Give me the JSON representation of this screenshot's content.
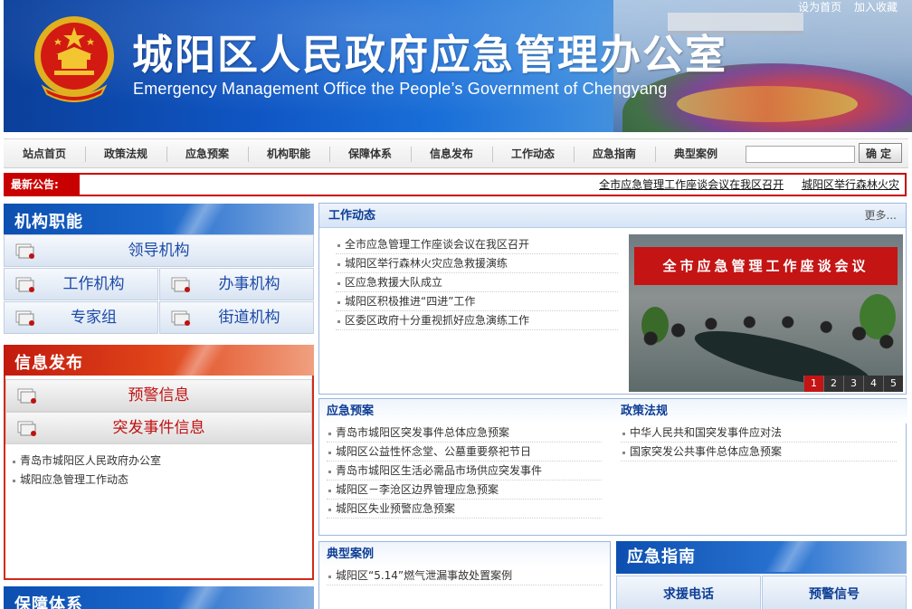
{
  "header": {
    "title": "城阳区人民政府应急管理办公室",
    "subtitle": "Emergency Management Office the People’s Government of Chengyang",
    "top_links": [
      "设为首页",
      "加入收藏"
    ]
  },
  "nav": {
    "items": [
      "站点首页",
      "政策法规",
      "应急预案",
      "机构职能",
      "保障体系",
      "信息发布",
      "工作动态",
      "应急指南",
      "典型案例"
    ],
    "search_placeholder": "",
    "search_button": "确定"
  },
  "notice": {
    "label": "最新公告:",
    "links": [
      "全市应急管理工作座谈会议在我区召开",
      "城阳区举行森林火灾"
    ]
  },
  "jigou": {
    "title": "机构职能",
    "items": [
      "领导机构",
      "工作机构",
      "办事机构",
      "专家组",
      "街道机构"
    ]
  },
  "xinxi": {
    "title": "信息发布",
    "items": [
      "预警信息",
      "突发事件信息"
    ],
    "list": [
      "青岛市城阳区人民政府办公室",
      "城阳应急管理工作动态"
    ]
  },
  "baozhang": {
    "title": "保障体系"
  },
  "gongzuo": {
    "title": "工作动态",
    "more": "更多...",
    "list": [
      "全市应急管理工作座谈会议在我区召开",
      "城阳区举行森林火灾应急救援演练",
      "区应急救援大队成立",
      "城阳区积极推进“四进”工作",
      "区委区政府十分重视抓好应急演练工作"
    ],
    "photo_caption": "全市应急管理工作座谈会议",
    "pager": [
      "1",
      "2",
      "3",
      "4",
      "5"
    ]
  },
  "yuan": {
    "title": "应急预案",
    "list": [
      "青岛市城阳区突发事件总体应急预案",
      "城阳区公益性怀念堂、公墓重要祭祀节日",
      "青岛市城阳区生活必需品市场供应突发事件",
      "城阳区－李沧区边界管理应急预案",
      "城阳区失业预警应急预案"
    ]
  },
  "fagui": {
    "title": "政策法规",
    "list": [
      "中华人民共和国突发事件应对法",
      "国家突发公共事件总体应急预案"
    ]
  },
  "anli": {
    "title": "典型案例",
    "list": [
      "城阳区“5.14”燃气泄漏事故处置案例"
    ]
  },
  "guide": {
    "title": "应急指南",
    "items": [
      "求援电话",
      "预警信号"
    ]
  },
  "colors": {
    "brand_blue": "#0c4fb0",
    "alert_red": "#c90000"
  }
}
